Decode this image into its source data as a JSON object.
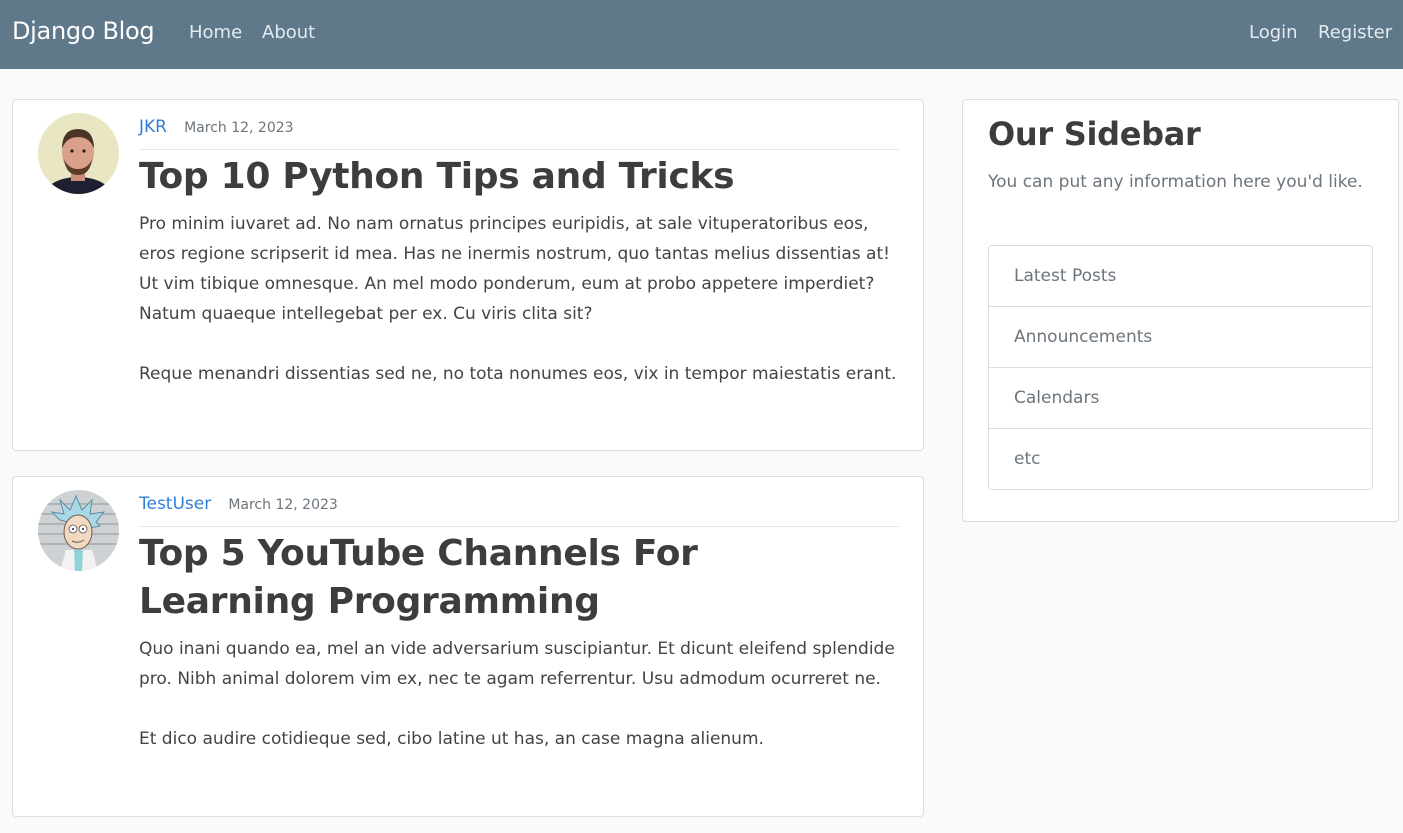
{
  "navbar": {
    "brand": "Django Blog",
    "left_links": [
      "Home",
      "About"
    ],
    "right_links": [
      "Login",
      "Register"
    ]
  },
  "posts": [
    {
      "author": "JKR",
      "date": "March 12, 2023",
      "title": "Top 10 Python Tips and Tricks",
      "paragraphs": [
        "Pro minim iuvaret ad. No nam ornatus principes euripidis, at sale vituperatoribus eos, eros regione scripserit id mea. Has ne inermis nostrum, quo tantas melius dissentias at! Ut vim tibique omnesque. An mel modo ponderum, eum at probo appetere imperdiet? Natum quaeque intellegebat per ex. Cu viris clita sit?",
        "Reque menandri dissentias sed ne, no tota nonumes eos, vix in tempor maiestatis erant."
      ],
      "avatar_icon": "user-photo-avatar-icon"
    },
    {
      "author": "TestUser",
      "date": "March 12, 2023",
      "title": "Top 5 YouTube Channels For Learning Programming",
      "paragraphs": [
        "Quo inani quando ea, mel an vide adversarium suscipiantur. Et dicunt eleifend splendide pro. Nibh animal dolorem vim ex, nec te agam referrentur. Usu admodum ocurreret ne.",
        "Et dico audire cotidieque sed, cibo latine ut has, an case magna alienum."
      ],
      "avatar_icon": "cartoon-avatar-icon"
    }
  ],
  "sidebar": {
    "title": "Our Sidebar",
    "description": "You can put any information here you'd like.",
    "items": [
      "Latest Posts",
      "Announcements",
      "Calendars",
      "etc"
    ]
  },
  "colors": {
    "navbar_bg": "#5f788a",
    "link": "#2f7fd8",
    "page_bg": "#fafafa"
  }
}
